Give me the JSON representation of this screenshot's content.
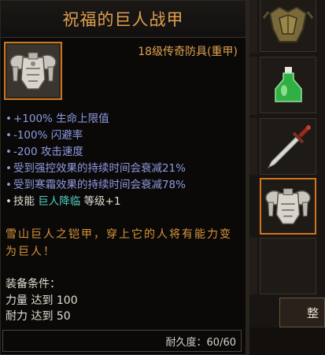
{
  "tooltip": {
    "title": "祝福的巨人战甲",
    "item_type": "18级传奇防具(重甲)",
    "stats": [
      {
        "bullet": "•",
        "text": "+100% 生命上限值"
      },
      {
        "bullet": "•",
        "text": "-100% 闪避率"
      },
      {
        "bullet": "•",
        "text": "-200 攻击速度"
      },
      {
        "bullet": "•",
        "text": "受到强控效果的持续时间会衰减21%"
      },
      {
        "bullet": "•",
        "text": "受到寒霜效果的持续时间会衰减78%"
      }
    ],
    "skill": {
      "bullet": "•",
      "prefix": "技能",
      "name": "巨人降临",
      "suffix": "等级+1"
    },
    "lore": "雪山巨人之铠甲，穿上它的人将有能力变为巨人！",
    "requirements": {
      "title": "装备条件：",
      "lines": [
        "力量 达到 100",
        "耐力 达到 50"
      ]
    },
    "durability": "耐久度：60/60"
  },
  "inventory": {
    "slots": [
      {
        "icon": "leaf-armor-icon"
      },
      {
        "icon": "green-potion-icon"
      },
      {
        "icon": "sword-icon"
      },
      {
        "icon": "plate-armor-icon",
        "selected": true
      },
      {
        "icon": "empty-slot"
      }
    ],
    "sort_button_label": "整"
  },
  "colors": {
    "title": "#e0a050",
    "stat_blue": "#8f9ae2",
    "skill_cyan": "#52cfc0",
    "lore_orange": "#d89438",
    "rarity_border": "#d0751f"
  }
}
